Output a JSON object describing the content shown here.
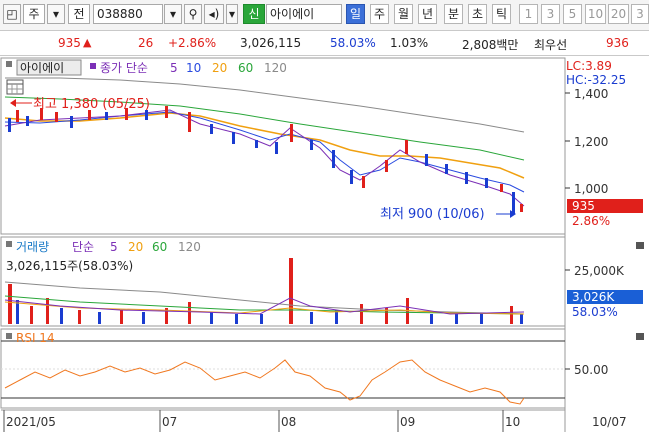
{
  "toolbar": {
    "type_label": "주",
    "mode_label": "전",
    "code_value": "038880",
    "credit_label": "신",
    "stock_name": "아이에이",
    "periods": [
      "일",
      "주",
      "월",
      "년",
      "분",
      "초",
      "틱"
    ],
    "numbers": [
      "1",
      "3",
      "5",
      "10",
      "20",
      "3"
    ]
  },
  "quote": {
    "price": "935",
    "change": "26",
    "change_pct": "+2.86%",
    "volume": "3,026,115",
    "volume_ratio": "58.03%",
    "turnover": "1.03%",
    "amount": "2,808백만",
    "best_label": "최우선",
    "best_price": "936"
  },
  "price_panel": {
    "stock_label": "아이에이",
    "ma_title": "종가 단순",
    "ma_periods": [
      "5",
      "10",
      "20",
      "60",
      "120"
    ],
    "lc": "LC:3.89",
    "hc": "HC:-32.25",
    "max_annot": "최고 1,380 (05/25)",
    "min_annot": "최저 900 (10/06)",
    "y_ticks": [
      "1,400",
      "1,200",
      "1,000"
    ],
    "current_price_tag": "935",
    "current_pct_tag": "2.86%"
  },
  "volume_panel": {
    "title": "거래량",
    "ma_title": "단순",
    "ma_periods": [
      "5",
      "20",
      "60",
      "120"
    ],
    "volume_label": "3,026,115주(58.03%)",
    "y_tick": "25,000K",
    "current_vol_tag": "3,026K",
    "current_pct_tag": "58.03%"
  },
  "rsi_panel": {
    "title": "RSI 14",
    "y_tick": "50.00"
  },
  "x_axis": {
    "labels": [
      "2021/05",
      "07",
      "08",
      "09",
      "10"
    ],
    "right_label": "10/07"
  },
  "chart_data": {
    "type": "line",
    "title": "",
    "xlabel": "",
    "ylabel": "",
    "x": [
      "2021/05",
      "07",
      "08",
      "09",
      "10"
    ],
    "series": [
      {
        "name": "종가",
        "values": [
          1300,
          1270,
          1220,
          1110,
          935
        ]
      }
    ],
    "ylim": [
      880,
      1420
    ]
  },
  "colors": {
    "up": "#e0201b",
    "down": "#1a3cd0",
    "ma5": "#7b2fb6",
    "ma10": "#2a4be0",
    "ma20": "#f0a010",
    "ma60": "#2aa63a",
    "ma120": "#8a8a8a",
    "rsi": "#f07820"
  }
}
